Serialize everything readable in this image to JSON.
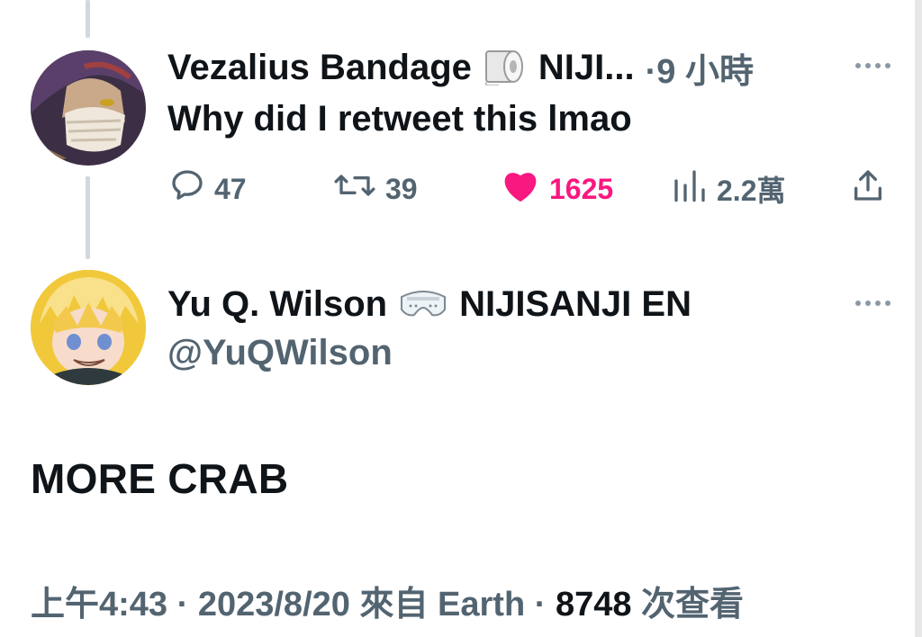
{
  "reply": {
    "display_name": "Vezalius Bandage",
    "name_suffix": "NIJI...",
    "time_ago": "·9 小時",
    "text": "Why did I retweet this lmao",
    "stats": {
      "replies": "47",
      "retweets": "39",
      "likes": "1625",
      "views": "2.2萬"
    }
  },
  "tweet": {
    "display_name": "Yu Q. Wilson",
    "name_suffix": "NIJISANJI EN",
    "handle": "@YuQWilson",
    "text": "MORE CRAB",
    "footer": {
      "time": "上午4:43",
      "sep1": " · ",
      "date": "2023/8/20",
      "source_prefix": " 來自 ",
      "source": "Earth",
      "sep2": " · ",
      "views": "8748",
      "views_label": " 次查看"
    }
  },
  "colors": {
    "like": "#f91880",
    "secondary": "#536471",
    "thread_line": "#cfd9de"
  }
}
